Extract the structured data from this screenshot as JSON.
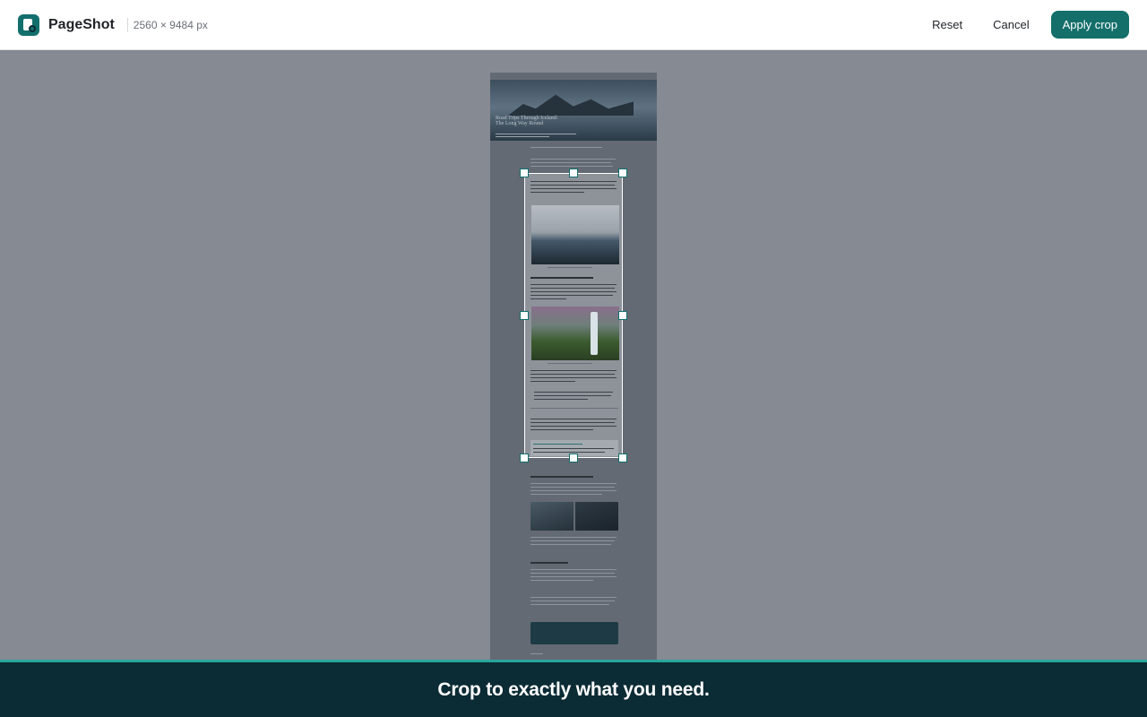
{
  "app": {
    "name": "PageShot",
    "dimensions": "2560 × 9484 px"
  },
  "toolbar": {
    "reset_label": "Reset",
    "cancel_label": "Cancel",
    "apply_label": "Apply crop"
  },
  "preview": {
    "hero_title_line1": "Road Trips Through Iceland:",
    "hero_title_line2": "The Long Way Round"
  },
  "banner": {
    "text": "Crop to exactly what you need."
  },
  "colors": {
    "accent": "#146f6b",
    "banner_bg": "#0b2b35",
    "banner_border": "#2aa59c",
    "workspace_bg": "#868a93"
  }
}
